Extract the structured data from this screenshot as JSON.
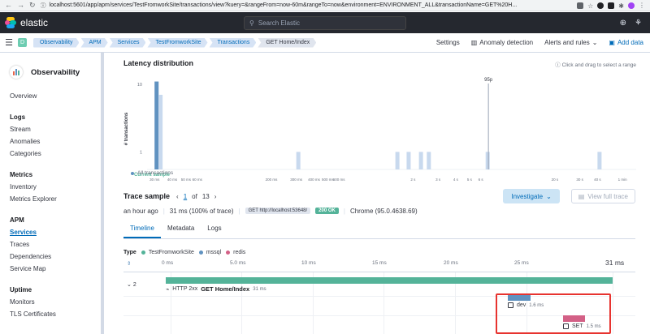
{
  "browser": {
    "url": "localhost:5601/app/apm/services/TestFromworkSite/transactions/view?kuery=&rangeFrom=now-60m&rangeTo=now&environment=ENVIRONMENT_ALL&transactionName=GET%20H..."
  },
  "header": {
    "brand": "elastic",
    "search_placeholder": "Search Elastic"
  },
  "breadcrumbs": {
    "space_letter": "D",
    "items": [
      "Observability",
      "APM",
      "Services",
      "TestFromworkSite",
      "Transactions",
      "GET Home/Index"
    ],
    "actions": [
      "Settings",
      "Anomaly detection",
      "Alerts and rules",
      "Add data"
    ]
  },
  "sidebar": {
    "title": "Observability",
    "overview": "Overview",
    "logs": {
      "heading": "Logs",
      "items": [
        "Stream",
        "Anomalies",
        "Categories"
      ]
    },
    "metrics": {
      "heading": "Metrics",
      "items": [
        "Inventory",
        "Metrics Explorer"
      ]
    },
    "apm": {
      "heading": "APM",
      "items": [
        "Services",
        "Traces",
        "Dependencies",
        "Service Map"
      ]
    },
    "uptime": {
      "heading": "Uptime",
      "items": [
        "Monitors",
        "TLS Certificates"
      ]
    }
  },
  "latency": {
    "title": "Latency distribution",
    "drag_hint": "Click and drag to select a range",
    "current_sample_label": "Current sample",
    "percentile_label": "95p",
    "all_transactions_label": "All transactions",
    "colors": {
      "bars": "#c8d9ee",
      "current": "#6092c0",
      "current_text": "#54b399"
    }
  },
  "chart_data": {
    "type": "bar",
    "title": "Latency distribution",
    "xlabel": "",
    "ylabel": "# transactions",
    "y_scale": "log",
    "ylim": [
      1,
      10
    ],
    "yticks": [
      "10",
      "1"
    ],
    "xticks": [
      "30 ms",
      "40 ms",
      "50 ms",
      "60 ms",
      "200 ms",
      "300 ms",
      "400 ms",
      "500 ms",
      "600 ms",
      "2 s",
      "3 s",
      "4 s",
      "5 s",
      "6 s",
      "20 s",
      "30 s",
      "40 s",
      "1 min"
    ],
    "series": [
      {
        "name": "All transactions",
        "values": [
          {
            "x": "30 ms",
            "y": 11
          },
          {
            "x": "32 ms",
            "y": 7
          },
          {
            "x": "300 ms",
            "y": 1
          },
          {
            "x": "1.5 s",
            "y": 1
          },
          {
            "x": "1.8 s",
            "y": 1
          },
          {
            "x": "2.2 s",
            "y": 1
          },
          {
            "x": "2.5 s",
            "y": 1
          },
          {
            "x": "6.5 s",
            "y": 1
          },
          {
            "x": "40 s",
            "y": 1
          }
        ]
      }
    ],
    "legend": "bottom-left"
  },
  "trace": {
    "title": "Trace sample",
    "current": "1",
    "of_label": "of",
    "total": "13",
    "investigate": "Investigate",
    "full_trace": "View full trace",
    "age": "an hour ago",
    "duration": "31 ms (100% of trace)",
    "request": "GET http://localhost:53648/",
    "status": "200 OK",
    "browser": "Chrome (95.0.4638.69)"
  },
  "tabs": [
    "Timeline",
    "Metadata",
    "Logs"
  ],
  "timeline": {
    "type_label": "Type",
    "legend": [
      {
        "name": "TestFromworkSite",
        "color": "#54b399"
      },
      {
        "name": "mssql",
        "color": "#6092c0"
      },
      {
        "name": "redis",
        "color": "#d36086"
      }
    ],
    "ticks": [
      "0 ms",
      "5.0 ms",
      "10 ms",
      "15 ms",
      "20 ms",
      "25 ms",
      "31 ms"
    ],
    "root_count": "2",
    "root_http": "HTTP 2xx",
    "root_name": "GET Home/Index",
    "root_duration": "31 ms",
    "span_dev": {
      "name": "dev",
      "duration": "1.6 ms"
    },
    "span_set": {
      "name": "SET",
      "duration": "1.5 ms"
    }
  }
}
